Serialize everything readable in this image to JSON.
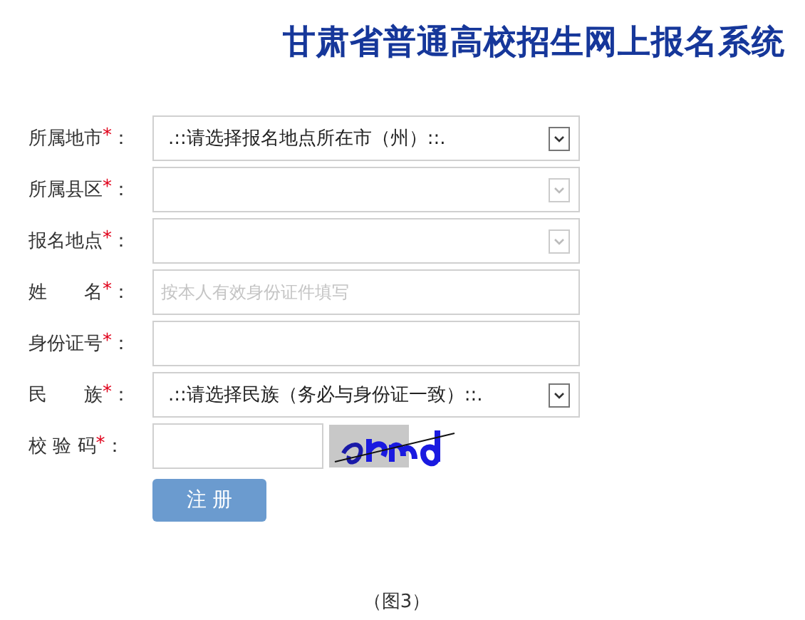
{
  "title": "甘肃省普通高校招生网上报名系统",
  "fields": [
    {
      "kind": "select",
      "label": "所属地市",
      "required_mark": "*",
      "colon": "：",
      "value": ".::请选择报名地点所在市（州）::.",
      "disabled": false
    },
    {
      "kind": "select",
      "label": "所属县区",
      "required_mark": "*",
      "colon": "：",
      "disabled": true
    },
    {
      "kind": "select",
      "label": "报名地点",
      "required_mark": "*",
      "colon": "：",
      "disabled": true
    },
    {
      "kind": "input",
      "label": "姓　　名",
      "required_mark": "*",
      "colon": "：",
      "placeholder": "按本人有效身份证件填写"
    },
    {
      "kind": "input",
      "label": "身份证号",
      "required_mark": "*",
      "colon": "："
    },
    {
      "kind": "select",
      "label": "民　　族",
      "required_mark": "*",
      "colon": "：",
      "value": ".::请选择民族（务必与身份证一致）::.",
      "disabled": false
    },
    {
      "kind": "captcha",
      "label": "校 验 码",
      "required_mark": "*",
      "colon": "："
    }
  ],
  "submit_button": "注 册",
  "caption": "（图3）"
}
